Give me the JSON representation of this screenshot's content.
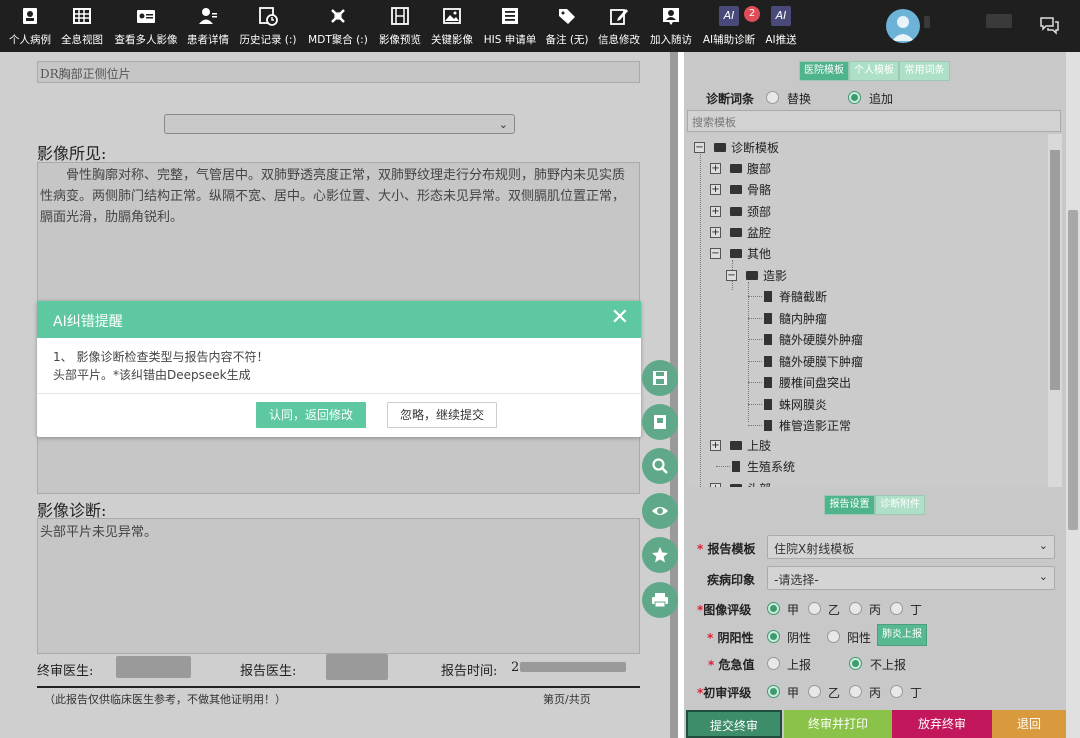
{
  "toolbar": {
    "items": [
      {
        "label": "个人病例",
        "icon": "person-card-icon"
      },
      {
        "label": "全息视图",
        "icon": "grid-icon"
      },
      {
        "label": "查看多人影像",
        "icon": "id-card-icon"
      },
      {
        "label": "患者详情",
        "icon": "user-detail-icon"
      },
      {
        "label": "历史记录 (:)",
        "icon": "history-icon"
      },
      {
        "label": "MDT聚合 (:)",
        "icon": "mdt-icon"
      },
      {
        "label": "影像预览",
        "icon": "film-icon"
      },
      {
        "label": "关键影像",
        "icon": "image-icon"
      },
      {
        "label": "HIS 申请单",
        "icon": "list-icon"
      },
      {
        "label": "备注 (无)",
        "icon": "tag-icon"
      },
      {
        "label": "信息修改",
        "icon": "edit-icon"
      },
      {
        "label": "加入随访",
        "icon": "follow-up-icon"
      },
      {
        "label": "AI辅助诊断",
        "icon": "ai-icon",
        "badge": "2"
      },
      {
        "label": "AI推送",
        "icon": "ai-icon"
      }
    ]
  },
  "report": {
    "exam_name": "DR胸部正侧位片",
    "findings_heading": "影像所见:",
    "findings_text": "骨性胸廓对称、完整，气管居中。双肺野透亮度正常，双肺野纹理走行分布规则，肺野内未见实质性病变。两侧肺门结构正常。纵隔不宽、居中。心影位置、大小、形态未见异常。双侧膈肌位置正常，膈面光滑，肋膈角锐利。",
    "diagnosis_heading": "影像诊断:",
    "diagnosis_text": "头部平片未见异常。",
    "final_doctor_label": "终审医生:",
    "report_doctor_label": "报告医生:",
    "report_time_label": "报告时间:",
    "report_time_value": "2",
    "footnote": "（此报告仅供临床医生参考，不做其他证明用！）",
    "page_info": "第页/共页"
  },
  "dialog": {
    "title": "AI纠错提醒",
    "line1": "1、 影像诊断检查类型与报告内容不符！",
    "line2": "头部平片。*该纠错由Deepseek生成",
    "accept_label": "认同，返回修改",
    "ignore_label": "忽略，继续提交"
  },
  "side_panel": {
    "template_tabs": [
      "医院模板",
      "个人模板",
      "常用词条"
    ],
    "diag_terms_label": "诊断词条",
    "replace_label": "替换",
    "append_label": "追加",
    "search_placeholder": "搜索模板",
    "tree": {
      "root": "诊断模板",
      "folders": [
        "腹部",
        "骨骼",
        "颈部",
        "盆腔",
        "其他"
      ],
      "sub_folder": "造影",
      "leaves": [
        "脊髓截断",
        "髓内肿瘤",
        "髓外硬膜外肿瘤",
        "髓外硬膜下肿瘤",
        "腰椎间盘突出",
        "蛛网膜炎",
        "椎管造影正常"
      ],
      "after": [
        "上肢",
        "生殖系统",
        "头部"
      ]
    },
    "settings_tabs": [
      "报告设置",
      "诊断附件"
    ],
    "form": {
      "template_label": "报告模板",
      "template_value": "住院X射线模板",
      "impression_label": "疾病印象",
      "impression_value": "-请选择-",
      "image_grade_label": "图像评级",
      "grade_options": [
        "甲",
        "乙",
        "丙",
        "丁"
      ],
      "pos_neg_label": "阴阳性",
      "negative": "阴性",
      "positive": "阳性",
      "lung_report_btn": "肺炎上报",
      "critical_label": "危急值",
      "report_up": "上报",
      "no_report": "不上报",
      "initial_grade_label": "初审评级"
    },
    "bottom_buttons": [
      {
        "label": "提交终审",
        "color": "#3d8c6a"
      },
      {
        "label": "终审并打印",
        "color": "#8bc34a"
      },
      {
        "label": "放弃终审",
        "color": "#c2185b"
      },
      {
        "label": "退回",
        "color": "#d89a3c"
      }
    ]
  }
}
